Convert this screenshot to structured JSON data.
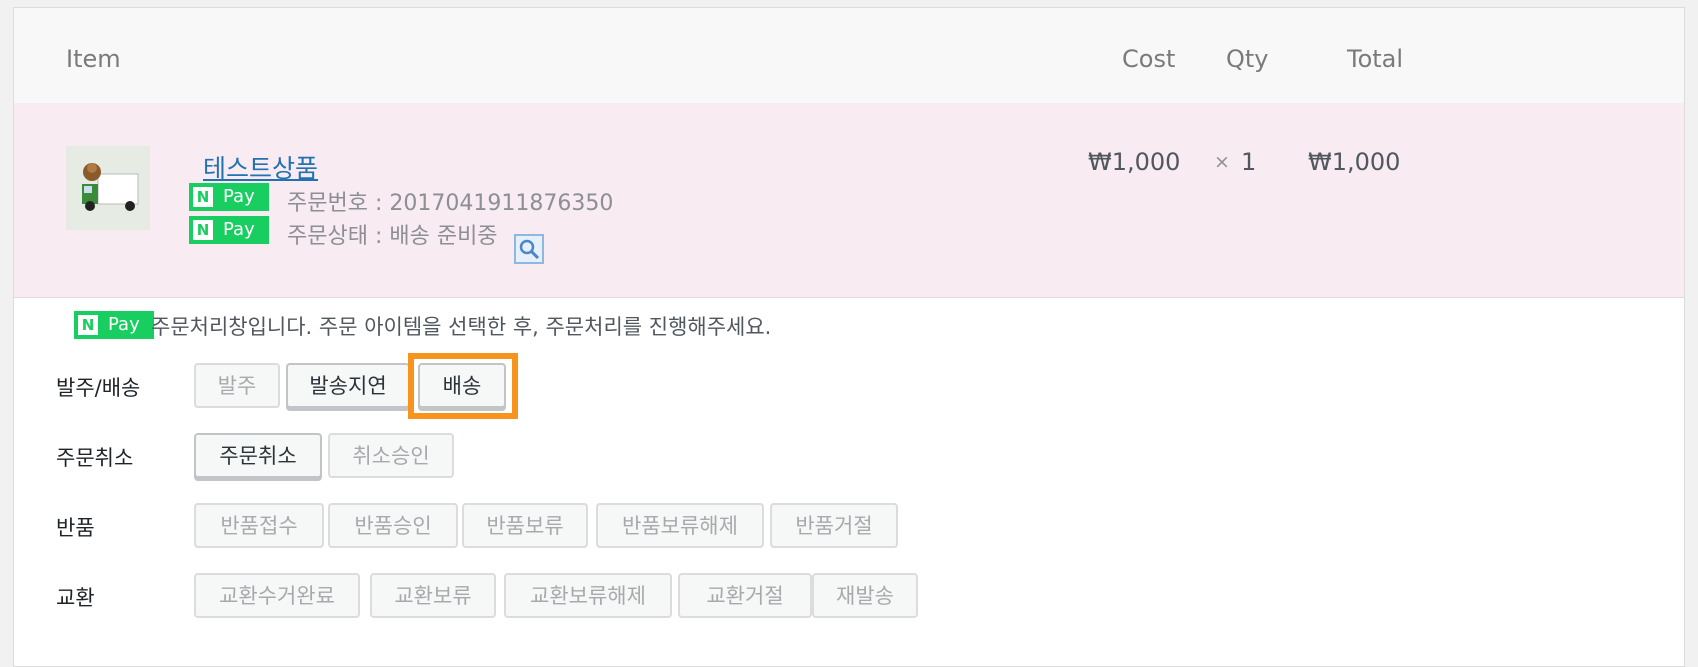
{
  "table": {
    "headers": {
      "item": "Item",
      "cost": "Cost",
      "qty": "Qty",
      "total": "Total"
    }
  },
  "product": {
    "name": "테스트상품",
    "order_number": "주문번호 : 2017041911876350",
    "order_status": "주문상태 : 배송 준비중",
    "cost": "₩1,000",
    "qty_x": "×",
    "qty": "1",
    "total": "₩1,000"
  },
  "npay": {
    "n": "N",
    "pay": "Pay"
  },
  "notice": "주문처리창입니다. 주문 아이템을 선택한 후, 주문처리를 진행해주세요.",
  "groups": [
    {
      "label": "발주/배송",
      "buttons": [
        "발주",
        "발송지연",
        "배송"
      ]
    },
    {
      "label": "주문취소",
      "buttons": [
        "주문취소",
        "취소승인"
      ]
    },
    {
      "label": "반품",
      "buttons": [
        "반품접수",
        "반품승인",
        "반품보류",
        "반품보류해제",
        "반품거절"
      ]
    },
    {
      "label": "교환",
      "buttons": [
        "교환수거완료",
        "교환보류",
        "교환보류해제",
        "교환거절",
        "재발송"
      ]
    }
  ],
  "colors": {
    "npay_green": "#19ce60",
    "highlight": "#f7941d",
    "row_bg": "#f8ebf2"
  }
}
